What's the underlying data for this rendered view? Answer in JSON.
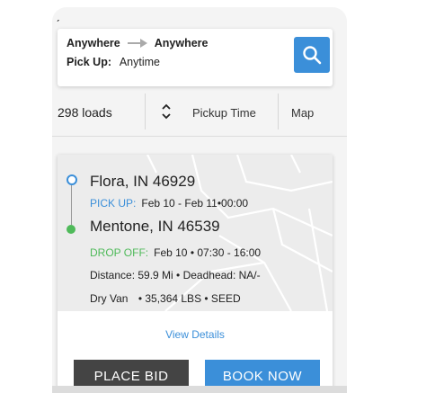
{
  "search": {
    "origin": "Anywhere",
    "destination": "Anywhere",
    "pickup_label": "Pick Up:",
    "pickup_value": "Anytime"
  },
  "toolbar": {
    "loads_count": "298 loads",
    "sort_label": "Pickup Time",
    "map_label": "Map"
  },
  "load": {
    "origin": "Flora, IN 46929",
    "pickup_tag": "PICK UP:",
    "pickup_time": "Feb 10 - Feb 11•00:00",
    "destination": "Mentone, IN 46539",
    "dropoff_tag": "DROP OFF:",
    "dropoff_time": "Feb 10 • 07:30 - 16:00",
    "distance": "Distance: 59.9 Mi • Deadhead: NA/-",
    "equipment": "Dry Van",
    "details": "• 35,364 LBS • SEED",
    "view_details": "View Details",
    "place_bid": "PLACE BID",
    "book_now": "BOOK NOW"
  },
  "colors": {
    "accent": "#3b8fd9",
    "green": "#4fba5a",
    "dark_button": "#444444"
  },
  "icons": {
    "search": "search-icon",
    "sort": "sort-arrows-icon",
    "back": "back-icon"
  }
}
